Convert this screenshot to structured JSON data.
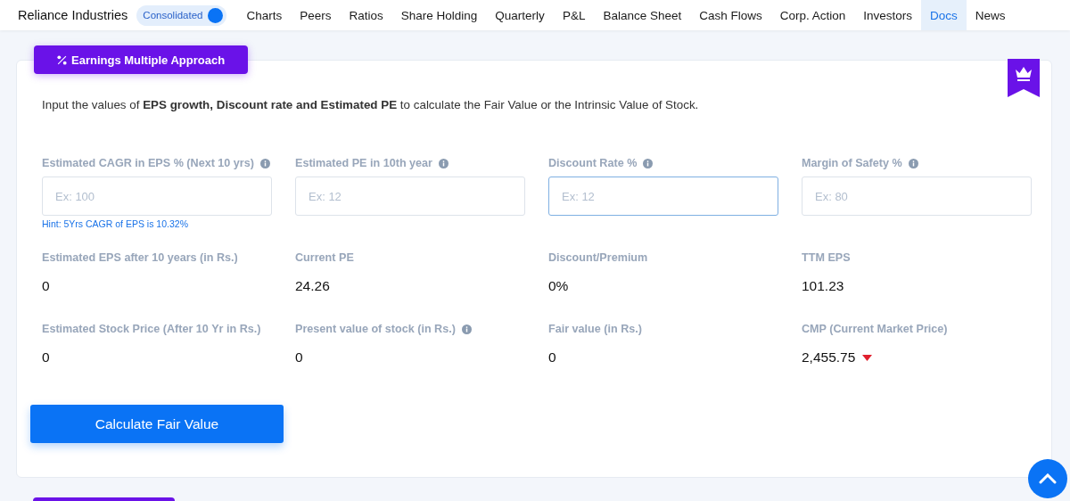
{
  "header": {
    "company": "Reliance Industries",
    "toggle": {
      "label": "Consolidated",
      "on": true
    },
    "tabs": [
      {
        "label": "Charts",
        "selected": false
      },
      {
        "label": "Peers",
        "selected": false
      },
      {
        "label": "Ratios",
        "selected": false
      },
      {
        "label": "Share Holding",
        "selected": false
      },
      {
        "label": "Quarterly",
        "selected": false
      },
      {
        "label": "P&L",
        "selected": false
      },
      {
        "label": "Balance Sheet",
        "selected": false
      },
      {
        "label": "Cash Flows",
        "selected": false
      },
      {
        "label": "Corp. Action",
        "selected": false
      },
      {
        "label": "Investors",
        "selected": false
      },
      {
        "label": "Docs",
        "selected": true
      },
      {
        "label": "News",
        "selected": false
      }
    ]
  },
  "section": {
    "title": "Earnings Multiple Approach",
    "premium": true,
    "intro": "Input the values of **EPS growth, Discount rate and Estimated PE** to calculate the Fair Value or the Intrinsic Value of Stock.",
    "inputs": [
      {
        "label": "Estimated CAGR in EPS % (Next 10 yrs)",
        "info": true,
        "placeholder": "Ex: 100",
        "focused": false,
        "hint": "Hint: 5Yrs CAGR of EPS is 10.32%"
      },
      {
        "label": "Estimated PE in 10th year",
        "info": true,
        "placeholder": "Ex: 12",
        "focused": false
      },
      {
        "label": "Discount Rate %",
        "info": true,
        "placeholder": "Ex: 12",
        "focused": true
      },
      {
        "label": "Margin of Safety %",
        "info": true,
        "placeholder": "Ex: 80",
        "focused": false
      }
    ],
    "results": [
      {
        "label": "Estimated EPS after 10 years (in Rs.)",
        "value": "0"
      },
      {
        "label": "Current PE",
        "value": "24.26"
      },
      {
        "label": "Discount/Premium",
        "value": "0%"
      },
      {
        "label": "TTM EPS",
        "value": "101.23"
      },
      {
        "label": "Estimated Stock Price (After 10 Yr in Rs.)",
        "value": "0"
      },
      {
        "label": "Present value of stock (in Rs.)",
        "info": true,
        "value": "0"
      },
      {
        "label": "Fair value (in Rs.)",
        "value": "0"
      },
      {
        "label": "CMP (Current Market Price)",
        "value": "2,455.75",
        "down": true
      }
    ],
    "button": "Calculate Fair Value"
  }
}
